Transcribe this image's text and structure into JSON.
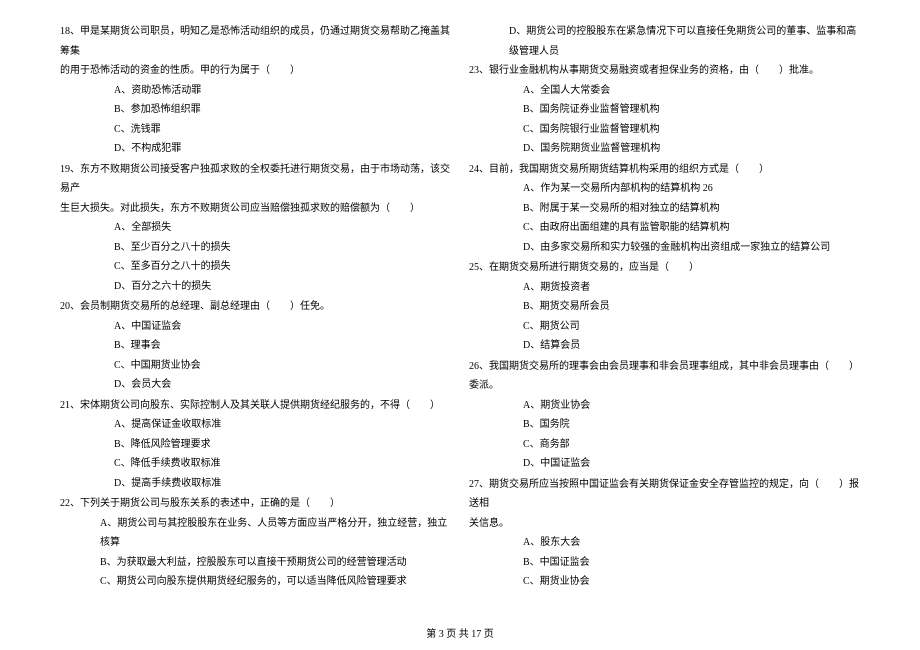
{
  "left": {
    "q18": {
      "text1": "18、甲是某期货公司职员，明知乙是恐怖活动组织的成员，仍通过期货交易帮助乙掩盖其筹集",
      "text2": "的用于恐怖活动的资金的性质。甲的行为属于（　　）",
      "optA": "A、资助恐怖活动罪",
      "optB": "B、参加恐怖组织罪",
      "optC": "C、洗钱罪",
      "optD": "D、不构成犯罪"
    },
    "q19": {
      "text1": "19、东方不败期货公司接受客户独孤求败的全权委托进行期货交易，由于市场动荡，该交易产",
      "text2": "生巨大损失。对此损失，东方不败期货公司应当赔偿独孤求败的赔偿额为（　　）",
      "optA": "A、全部损失",
      "optB": "B、至少百分之八十的损失",
      "optC": "C、至多百分之八十的损失",
      "optD": "D、百分之六十的损失"
    },
    "q20": {
      "text": "20、会员制期货交易所的总经理、副总经理由（　　）任免。",
      "optA": "A、中国证监会",
      "optB": "B、理事会",
      "optC": "C、中国期货业协会",
      "optD": "D、会员大会"
    },
    "q21": {
      "text": "21、宋体期货公司向股东、实际控制人及其关联人提供期货经纪服务的，不得（　　）",
      "optA": "A、提高保证金收取标准",
      "optB": "B、降低风险管理要求",
      "optC": "C、降低手续费收取标准",
      "optD": "D、提高手续费收取标准"
    },
    "q22": {
      "text": "22、下列关于期货公司与股东关系的表述中，正确的是（　　）",
      "optA": "A、期货公司与其控股股东在业务、人员等方面应当严格分开，独立经营，独立核算",
      "optB": "B、为获取最大利益，控股股东可以直接干预期货公司的经营管理活动",
      "optC": "C、期货公司向股东提供期货经纪服务的，可以适当降低风险管理要求"
    }
  },
  "right": {
    "q22d": "D、期货公司的控股股东在紧急情况下可以直接任免期货公司的董事、监事和高级管理人员",
    "q23": {
      "text": "23、银行业金融机构从事期货交易融资或者担保业务的资格，由（　　）批准。",
      "optA": "A、全国人大常委会",
      "optB": "B、国务院证券业监督管理机构",
      "optC": "C、国务院银行业监督管理机构",
      "optD": "D、国务院期货业监督管理机构"
    },
    "q24": {
      "text": "24、目前，我国期货交易所期货结算机构采用的组织方式是（　　）",
      "optA": "A、作为某一交易所内部机构的结算机构 26",
      "optB": "B、附属于某一交易所的相对独立的结算机构",
      "optC": "C、由政府出面组建的具有监管职能的结算机构",
      "optD": "D、由多家交易所和实力较强的金融机构出资组成一家独立的结算公司"
    },
    "q25": {
      "text": "25、在期货交易所进行期货交易的，应当是（　　）",
      "optA": "A、期货投资者",
      "optB": "B、期货交易所会员",
      "optC": "C、期货公司",
      "optD": "D、结算会员"
    },
    "q26": {
      "text": "26、我国期货交易所的理事会由会员理事和非会员理事组成，其中非会员理事由（　　）委派。",
      "optA": "A、期货业协会",
      "optB": "B、国务院",
      "optC": "C、商务部",
      "optD": "D、中国证监会"
    },
    "q27": {
      "text1": "27、期货交易所应当按照中国证监会有关期货保证金安全存管监控的规定，向（　　）报送相",
      "text2": "关信息。",
      "optA": "A、股东大会",
      "optB": "B、中国证监会",
      "optC": "C、期货业协会"
    }
  },
  "footer": "第 3 页 共 17 页"
}
